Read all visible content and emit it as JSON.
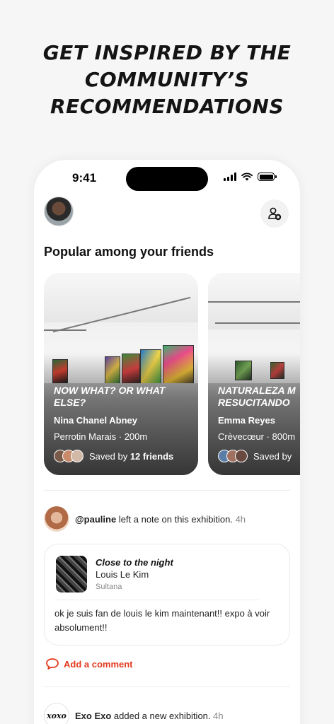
{
  "headline": "GET INSPIRED BY THE COMMUNITY’S RECOMMENDATIONS",
  "status_bar": {
    "time": "9:41"
  },
  "header": {
    "add_friend_icon": "add-user-icon"
  },
  "section": {
    "title": "Popular among your friends"
  },
  "cards": [
    {
      "title": "NOW WHAT? OR WHAT ELSE?",
      "artist": "Nina Chanel Abney",
      "location": "Perrotin Marais · 200m",
      "saved_prefix": "Saved by ",
      "saved_count": "12 friends"
    },
    {
      "title": "NATURALEZA M RESUCITANDO",
      "artist": "Emma Reyes",
      "location": "Crèvecœur · 800m",
      "saved_prefix": "Saved by",
      "saved_count": ""
    }
  ],
  "feed": {
    "note": {
      "user": "@pauline",
      "action": " left a note on this exhibition.",
      "time": " 4h",
      "exhibition_title": "Close to the night",
      "exhibition_artist": "Louis Le Kim",
      "exhibition_gallery": "Sultana",
      "body": "ok je suis fan de louis le kim maintenant!! expo à voir absolument!!"
    },
    "add_comment": "Add a comment",
    "second": {
      "avatar_text": "xoxo",
      "user": "Exo Exo",
      "action": " added a new exhibition.",
      "time": " 4h"
    }
  },
  "colors": {
    "accent": "#e23a1e",
    "background": "#f6f6f6",
    "card_text": "#ffffff"
  }
}
